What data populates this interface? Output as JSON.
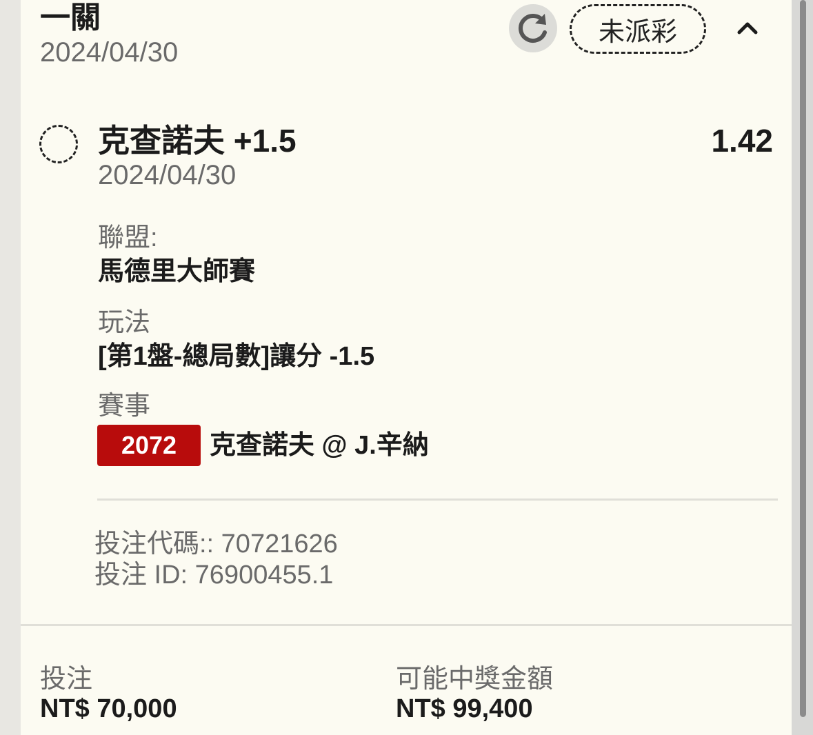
{
  "ticket": {
    "title": "一關",
    "date": "2024/04/30",
    "status": "未派彩"
  },
  "icons": {
    "refresh": "refresh-icon",
    "collapse": "chevron-up-icon",
    "select": "dashed-circle-icon"
  },
  "selection": {
    "name": "克查諾夫 +1.5",
    "odds": "1.42",
    "date": "2024/04/30",
    "league_label": "聯盟:",
    "league_value": "馬德里大師賽",
    "market_label": "玩法",
    "market_value": "[第1盤-總局數]讓分 -1.5",
    "event_label": "賽事",
    "event_code": "2072",
    "event_name": "克查諾夫 @ J.辛納"
  },
  "bet_code_line": "投注代碼:: 70721626",
  "bet_id_line": "投注 ID: 76900455.1",
  "footer": {
    "stake_label": "投注",
    "stake_value": "NT$ 70,000",
    "payout_label": "可能中獎金額",
    "payout_value": "NT$ 99,400"
  },
  "colors": {
    "event_badge": "#b80c0c",
    "card_bg": "#fcfbf2"
  }
}
